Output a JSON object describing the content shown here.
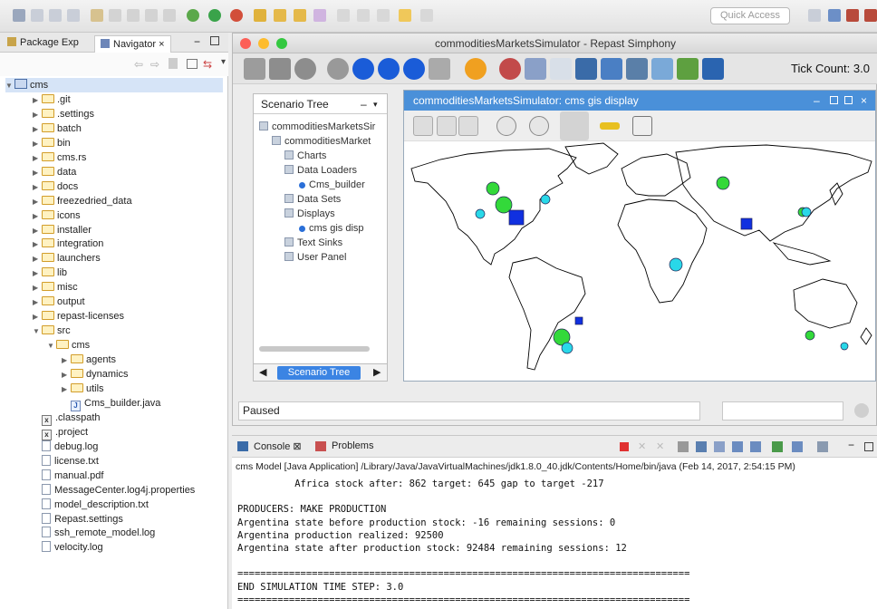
{
  "toolbar": {
    "quick_access_placeholder": "Quick Access"
  },
  "navigator": {
    "tab_package": "Package Exp",
    "tab_navigator": "Navigator",
    "tree": [
      {
        "label": "cms",
        "level": 0,
        "kind": "project",
        "open": true
      },
      {
        "label": ".git",
        "level": 1,
        "kind": "folder"
      },
      {
        "label": ".settings",
        "level": 1,
        "kind": "folder"
      },
      {
        "label": "batch",
        "level": 1,
        "kind": "folder"
      },
      {
        "label": "bin",
        "level": 1,
        "kind": "folder"
      },
      {
        "label": "cms.rs",
        "level": 1,
        "kind": "folder"
      },
      {
        "label": "data",
        "level": 1,
        "kind": "folder"
      },
      {
        "label": "docs",
        "level": 1,
        "kind": "folder"
      },
      {
        "label": "freezedried_data",
        "level": 1,
        "kind": "folder"
      },
      {
        "label": "icons",
        "level": 1,
        "kind": "folder"
      },
      {
        "label": "installer",
        "level": 1,
        "kind": "folder"
      },
      {
        "label": "integration",
        "level": 1,
        "kind": "folder"
      },
      {
        "label": "launchers",
        "level": 1,
        "kind": "folder"
      },
      {
        "label": "lib",
        "level": 1,
        "kind": "folder"
      },
      {
        "label": "misc",
        "level": 1,
        "kind": "folder"
      },
      {
        "label": "output",
        "level": 1,
        "kind": "folder"
      },
      {
        "label": "repast-licenses",
        "level": 1,
        "kind": "folder"
      },
      {
        "label": "src",
        "level": 1,
        "kind": "folder",
        "open": true
      },
      {
        "label": "cms",
        "level": 2,
        "kind": "folder",
        "open": true
      },
      {
        "label": "agents",
        "level": 3,
        "kind": "folder"
      },
      {
        "label": "dynamics",
        "level": 3,
        "kind": "folder"
      },
      {
        "label": "utils",
        "level": 3,
        "kind": "folder"
      },
      {
        "label": "Cms_builder.java",
        "level": 3,
        "kind": "java"
      },
      {
        "label": ".classpath",
        "level": 1,
        "kind": "xml"
      },
      {
        "label": ".project",
        "level": 1,
        "kind": "xml"
      },
      {
        "label": "debug.log",
        "level": 1,
        "kind": "file"
      },
      {
        "label": "license.txt",
        "level": 1,
        "kind": "file"
      },
      {
        "label": "manual.pdf",
        "level": 1,
        "kind": "file"
      },
      {
        "label": "MessageCenter.log4j.properties",
        "level": 1,
        "kind": "file"
      },
      {
        "label": "model_description.txt",
        "level": 1,
        "kind": "file"
      },
      {
        "label": "Repast.settings",
        "level": 1,
        "kind": "file"
      },
      {
        "label": "ssh_remote_model.log",
        "level": 1,
        "kind": "file"
      },
      {
        "label": "velocity.log",
        "level": 1,
        "kind": "file"
      }
    ]
  },
  "repast": {
    "window_title": "commoditiesMarketsSimulator - Repast Simphony",
    "tick_label": "Tick Count: 3.0",
    "scenario_header": "Scenario Tree",
    "scenario_tab": "Scenario Tree",
    "scenario_items": [
      {
        "label": "commoditiesMarketsSir",
        "indent": 0
      },
      {
        "label": "commoditiesMarket",
        "indent": 1
      },
      {
        "label": "Charts",
        "indent": 2
      },
      {
        "label": "Data Loaders",
        "indent": 2
      },
      {
        "label": "Cms_builder",
        "indent": 3
      },
      {
        "label": "Data Sets",
        "indent": 2
      },
      {
        "label": "Displays",
        "indent": 2
      },
      {
        "label": "cms gis disp",
        "indent": 3
      },
      {
        "label": "Text Sinks",
        "indent": 2
      },
      {
        "label": "User Panel",
        "indent": 2
      }
    ],
    "gis_title": "commoditiesMarketsSimulator: cms gis display",
    "status": "Paused",
    "agent_colors": {
      "cyan": "#29d8e8",
      "green": "#33d93a",
      "blue": "#1030e0"
    }
  },
  "console": {
    "tab_console": "Console",
    "tab_problems": "Problems",
    "process_path": "cms Model [Java Application] /Library/Java/JavaVirtualMachines/jdk1.8.0_40.jdk/Contents/Home/bin/java (Feb 14, 2017, 2:54:15 PM)",
    "lines": [
      "          Africa stock after: 862 target: 645 gap to target -217",
      "",
      "PRODUCERS: MAKE PRODUCTION",
      "Argentina state before production stock: -16 remaining sessions: 0",
      "Argentina production realized: 92500",
      "Argentina state after production stock: 92484 remaining sessions: 12",
      "",
      "===============================================================================",
      "END SIMULATION TIME STEP: 3.0",
      "==============================================================================="
    ]
  }
}
